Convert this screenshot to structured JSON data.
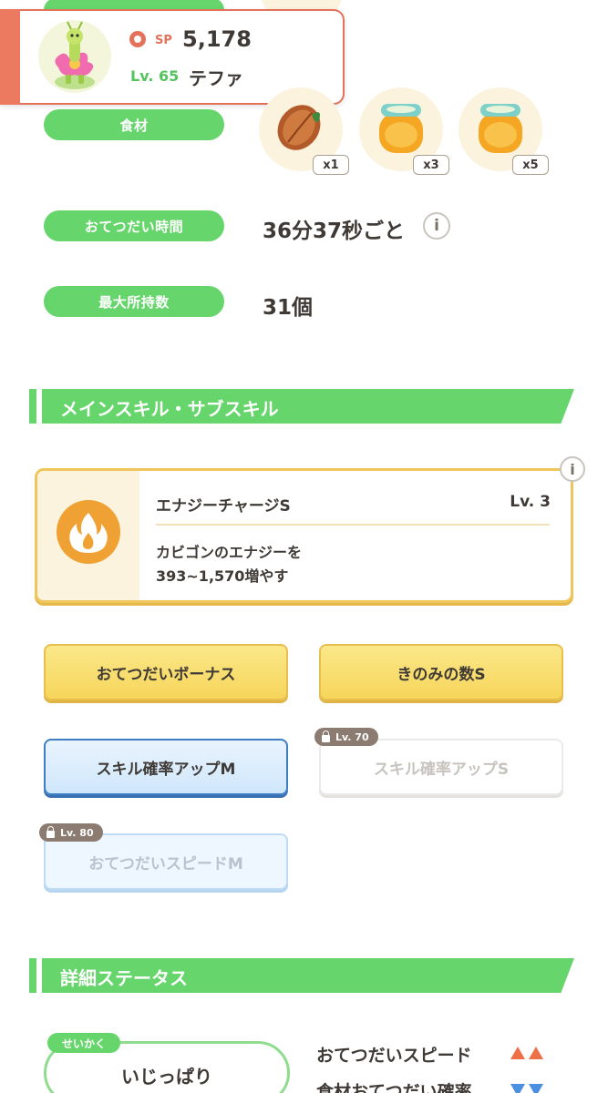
{
  "profile": {
    "sp_label": "SP",
    "sp_value": "5,178",
    "level": "Lv. 65",
    "name": "テファ"
  },
  "ingredients": {
    "label": "食材",
    "items": [
      {
        "icon": "cacao-bean-icon",
        "count": "x1"
      },
      {
        "icon": "honey-jar-icon",
        "count": "x3"
      },
      {
        "icon": "honey-jar-icon",
        "count": "x5"
      }
    ]
  },
  "help_time": {
    "label": "おてつだい時間",
    "value": "36分37秒ごと"
  },
  "max_carry": {
    "label": "最大所持数",
    "value": "31個"
  },
  "skills_section": {
    "title": "メインスキル・サブスキル"
  },
  "main_skill": {
    "name": "エナジーチャージS",
    "level": "Lv. 3",
    "desc_line1": "カビゴンのエナジーを",
    "desc_line2": "393~1,570増やす",
    "icon": "flame-icon"
  },
  "sub_skills": [
    {
      "label": "おてつだいボーナス",
      "state": "unlocked"
    },
    {
      "label": "きのみの数S",
      "state": "unlocked"
    },
    {
      "label": "スキル確率アップM",
      "state": "unlocked"
    },
    {
      "label": "スキル確率アップS",
      "state": "locked",
      "unlock_level": "Lv. 70"
    },
    {
      "label": "おてつだいスピードM",
      "state": "locked",
      "unlock_level": "Lv. 80"
    }
  ],
  "detail_section": {
    "title": "詳細ステータス"
  },
  "nature": {
    "badge": "せいかく",
    "value": "いじっぱり",
    "stats": [
      {
        "label": "おてつだいスピード",
        "direction": "up"
      },
      {
        "label": "食材おてつだい確率",
        "direction": "down"
      }
    ]
  },
  "colors": {
    "accent_green": "#66d56c",
    "profile_accent": "#ec7a60",
    "skill_gold": "#efc65b",
    "skill_blue": "#3f7ec7",
    "up_arrow": "#ef7047",
    "down_arrow": "#4b8fe0"
  }
}
